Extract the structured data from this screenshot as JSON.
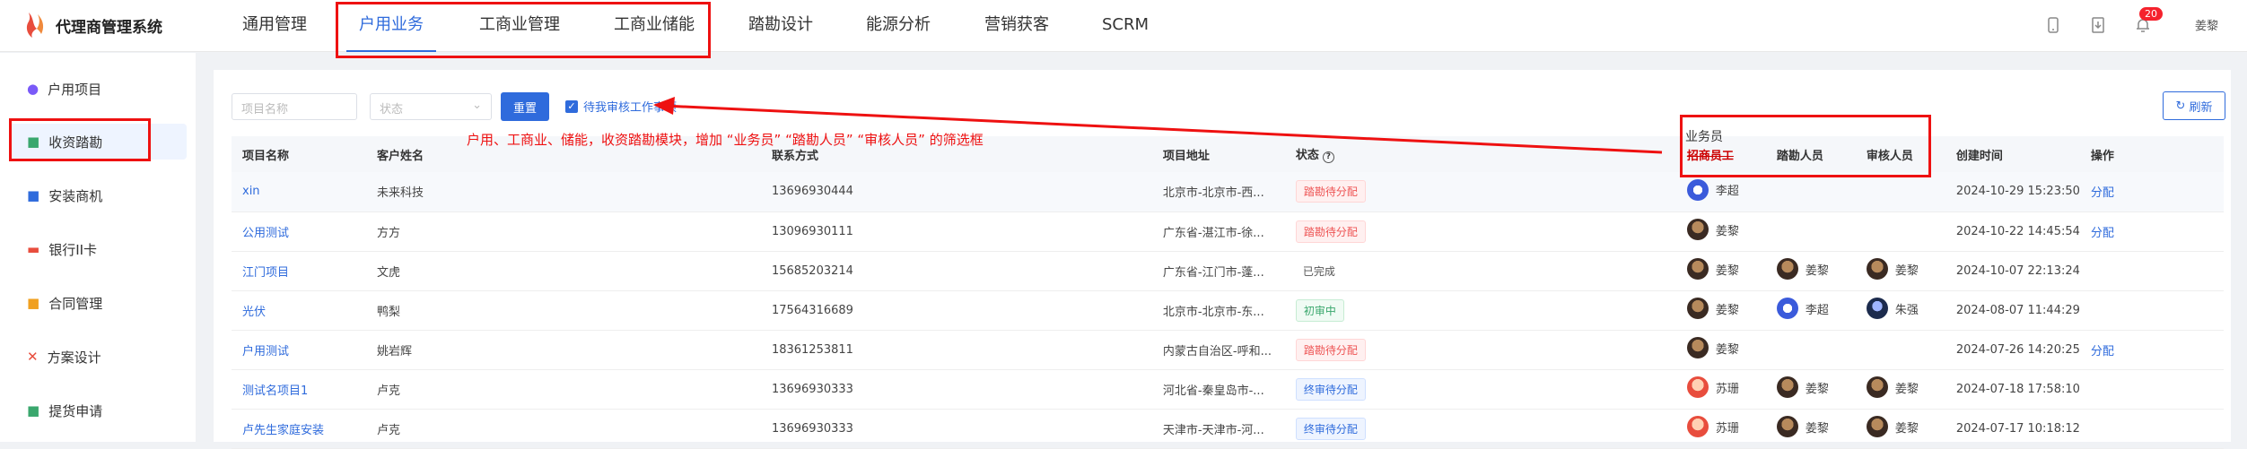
{
  "app": {
    "title": "代理商管理系统"
  },
  "nav": [
    {
      "label": "通用管理"
    },
    {
      "label": "户用业务"
    },
    {
      "label": "工商业管理"
    },
    {
      "label": "工商业储能"
    },
    {
      "label": "踏勘设计"
    },
    {
      "label": "能源分析"
    },
    {
      "label": "营销获客"
    },
    {
      "label": "SCRM"
    }
  ],
  "header": {
    "badge": "20",
    "user": "姜黎"
  },
  "sidebar": [
    {
      "label": "户用项目",
      "icon": "house-icon"
    },
    {
      "label": "收资踏勘",
      "icon": "document-icon"
    },
    {
      "label": "安装商机",
      "icon": "edit-icon"
    },
    {
      "label": "银行II卡",
      "icon": "card-icon"
    },
    {
      "label": "合同管理",
      "icon": "contract-icon"
    },
    {
      "label": "方案设计",
      "icon": "tools-icon"
    },
    {
      "label": "提货申请",
      "icon": "delivery-icon"
    }
  ],
  "filters": {
    "project_name_placeholder": "项目名称",
    "status_placeholder": "状态",
    "reset_label": "重置",
    "checkbox_label": "待我审核工作事项",
    "refresh_label": "刷新"
  },
  "annotation": {
    "text": "户用、工商业、储能，收资踏勘模块，增加 “业务员” “踏勘人员” “审核人员” 的筛选框",
    "biz_label": "业务员"
  },
  "table": {
    "headers": [
      "项目名称",
      "客户姓名",
      "联系方式",
      "项目地址",
      "状态",
      "招商员工",
      "踏勘人员",
      "审核人员",
      "创建时间",
      "操作"
    ],
    "rows": [
      {
        "project": "xin",
        "customer": "未来科技",
        "phone": "13696930444",
        "address": "北京市-北京市-西...",
        "status": "踏勘待分配",
        "status_type": "pink",
        "p1": "李超",
        "p1_av": "blue",
        "p2": "",
        "p2_av": "",
        "p3": "",
        "p3_av": "",
        "created": "2024-10-29 15:23:50",
        "op": "分配"
      },
      {
        "project": "公用测试",
        "customer": "方方",
        "phone": "13096930111",
        "address": "广东省-湛江市-徐...",
        "status": "踏勘待分配",
        "status_type": "pink",
        "p1": "姜黎",
        "p1_av": "dark",
        "p2": "",
        "p2_av": "",
        "p3": "",
        "p3_av": "",
        "created": "2024-10-22 14:45:54",
        "op": "分配"
      },
      {
        "project": "江门项目",
        "customer": "文虎",
        "phone": "15685203214",
        "address": "广东省-江门市-蓬...",
        "status": "已完成",
        "status_type": "plain",
        "p1": "姜黎",
        "p1_av": "dark",
        "p2": "姜黎",
        "p2_av": "dark",
        "p3": "姜黎",
        "p3_av": "dark",
        "created": "2024-10-07 22:13:24",
        "op": ""
      },
      {
        "project": "光伏",
        "customer": "鸭梨",
        "phone": "17564316689",
        "address": "北京市-北京市-东...",
        "status": "初审中",
        "status_type": "green",
        "p1": "姜黎",
        "p1_av": "dark",
        "p2": "李超",
        "p2_av": "blue",
        "p3": "朱强",
        "p3_av": "navy",
        "created": "2024-08-07 11:44:29",
        "op": ""
      },
      {
        "project": "户用测试",
        "customer": "姚岩辉",
        "phone": "18361253811",
        "address": "内蒙古自治区-呼和...",
        "status": "踏勘待分配",
        "status_type": "pink",
        "p1": "姜黎",
        "p1_av": "dark",
        "p2": "",
        "p2_av": "",
        "p3": "",
        "p3_av": "",
        "created": "2024-07-26 14:20:25",
        "op": "分配"
      },
      {
        "project": "测试名项目1",
        "customer": "卢克",
        "phone": "13696930333",
        "address": "河北省-秦皇岛市-...",
        "status": "终审待分配",
        "status_type": "blue",
        "p1": "苏珊",
        "p1_av": "red",
        "p2": "姜黎",
        "p2_av": "dark",
        "p3": "姜黎",
        "p3_av": "dark",
        "created": "2024-07-18 17:58:10",
        "op": ""
      },
      {
        "project": "卢先生家庭安装",
        "customer": "卢克",
        "phone": "13696930333",
        "address": "天津市-天津市-河...",
        "status": "终审待分配",
        "status_type": "blue",
        "p1": "苏珊",
        "p1_av": "red",
        "p2": "姜黎",
        "p2_av": "dark",
        "p3": "姜黎",
        "p3_av": "dark",
        "created": "2024-07-17 10:18:12",
        "op": ""
      }
    ]
  },
  "colors": {
    "accent": "#2f6bdc",
    "annotation": "#e11111"
  }
}
